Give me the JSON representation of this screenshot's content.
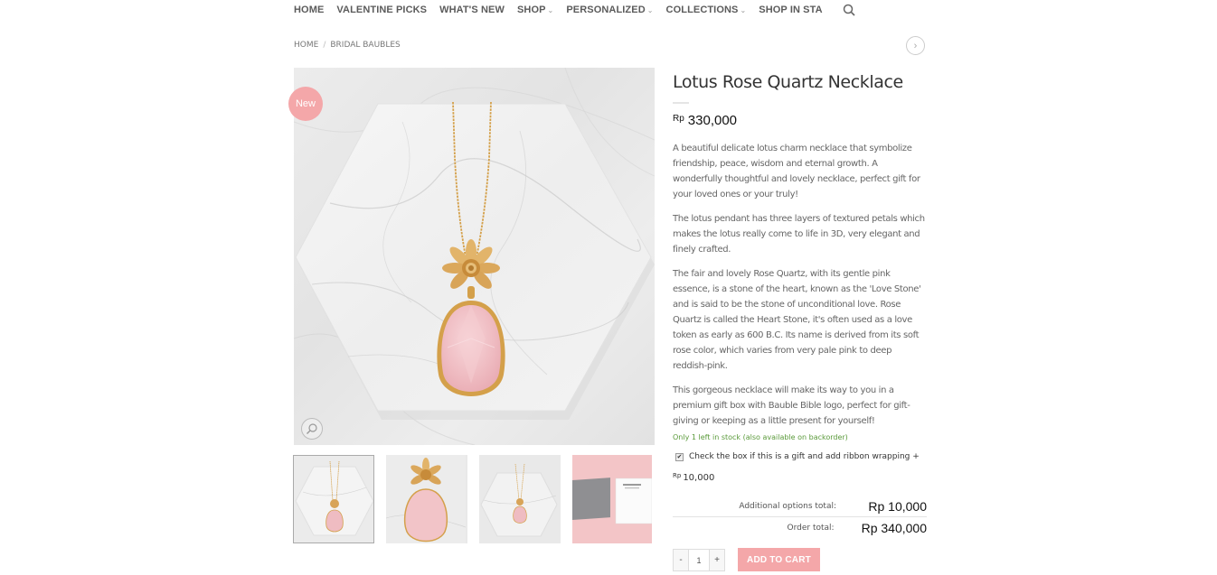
{
  "nav": {
    "items": [
      {
        "label": "HOME",
        "dropdown": false
      },
      {
        "label": "VALENTINE PICKS",
        "dropdown": false
      },
      {
        "label": "WHAT'S NEW",
        "dropdown": false
      },
      {
        "label": "SHOP",
        "dropdown": true
      },
      {
        "label": "PERSONALIZED",
        "dropdown": true
      },
      {
        "label": "COLLECTIONS",
        "dropdown": true
      },
      {
        "label": "SHOP IN STA",
        "dropdown": false
      }
    ],
    "search_icon": "search-icon"
  },
  "breadcrumb": {
    "home": "HOME",
    "separator": "/",
    "category": "BRIDAL BAUBLES"
  },
  "product": {
    "badge": "New",
    "title": "Lotus Rose Quartz Necklace",
    "currency": "Rp",
    "price": "330,000",
    "description": [
      "A beautiful delicate lotus charm necklace that symbolize friendship, peace, wisdom and eternal growth. A wonderfully thoughtful and lovely necklace, perfect gift for your loved ones or your truly!",
      "The lotus pendant has three layers of textured petals which makes the lotus really come to life in 3D, very elegant and finely crafted.",
      "The fair and lovely Rose Quartz, with its gentle pink essence, is a stone of the heart, known as the 'Love Stone' and is said to be the stone of unconditional love. Rose Quartz is called the Heart Stone, it's often used as a love token as early as 600 B.C. Its name is derived from its soft rose color, which varies from very pale pink to deep reddish-pink.",
      "This gorgeous necklace will make its way to you in a premium gift box with Bauble Bible logo, perfect for gift-giving or keeping as a little present for yourself!"
    ],
    "stock": "Only 1 left in stock (also available on backorder)",
    "gift_option": {
      "checked": true,
      "label": "Check the box if this is a gift and add ribbon wrapping +",
      "currency": "Rp",
      "price": "10,000"
    },
    "totals": {
      "additional_label": "Additional options total:",
      "additional_value": "Rp 10,000",
      "order_label": "Order total:",
      "order_value": "Rp 340,000"
    },
    "quantity": {
      "minus": "-",
      "value": "1",
      "plus": "+"
    },
    "add_to_cart": "ADD TO CART"
  },
  "colors": {
    "accent_pink": "#f4a7a9",
    "stock_green": "#5a9a3a",
    "gold": "#d4a04a",
    "quartz_pink": "#f2c4c8"
  }
}
